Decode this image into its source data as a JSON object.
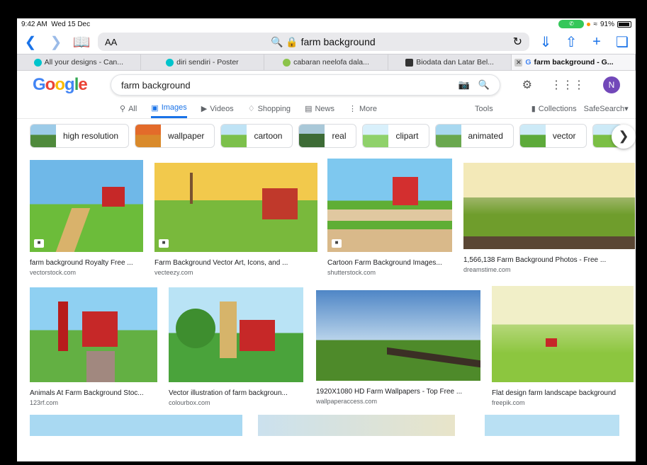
{
  "status": {
    "time": "9:42 AM",
    "date": "Wed 15 Dec",
    "battery": "91%"
  },
  "toolbar": {
    "aa": "AA",
    "url": "farm background"
  },
  "tabs": [
    {
      "label": "All your designs - Can...",
      "color": "#00c4cc"
    },
    {
      "label": "diri sendiri - Poster",
      "color": "#00c4cc"
    },
    {
      "label": "cabaran neelofa dala...",
      "color": "#8bc34a"
    },
    {
      "label": "Biodata dan Latar Bel...",
      "color": "#333333"
    },
    {
      "label": "farm background - G...",
      "color": "#4285f4"
    }
  ],
  "google": {
    "logo": [
      "G",
      "o",
      "o",
      "g",
      "l",
      "e"
    ],
    "query": "farm background",
    "avatar": "N"
  },
  "nav": {
    "all": "All",
    "images": "Images",
    "videos": "Videos",
    "shopping": "Shopping",
    "news": "News",
    "more": "More",
    "tools": "Tools",
    "collections": "Collections",
    "safesearch": "SafeSearch"
  },
  "chips": [
    {
      "label": "high resolution",
      "color": "#4f8a3c"
    },
    {
      "label": "wallpaper",
      "color": "#d98a2b"
    },
    {
      "label": "cartoon",
      "color": "#7cc04b"
    },
    {
      "label": "real",
      "color": "#3d6b36"
    },
    {
      "label": "clipart",
      "color": "#8fd16a"
    },
    {
      "label": "animated",
      "color": "#6aa84f"
    },
    {
      "label": "vector",
      "color": "#5daa3a"
    }
  ],
  "results": [
    {
      "title": "farm background Royalty Free ...",
      "source": "vectorstock.com",
      "sky": "#6fb8e8",
      "ground": "#6cbc3a"
    },
    {
      "title": "Farm Background Vector Art, Icons, and ...",
      "source": "vecteezy.com",
      "sky": "#f2c94c",
      "ground": "#79b93c"
    },
    {
      "title": "Cartoon Farm Background Images...",
      "source": "shutterstock.com",
      "sky": "#7ec8ef",
      "ground": "#5fae35"
    },
    {
      "title": "1,566,138 Farm Background Photos - Free ...",
      "source": "dreamstime.com",
      "sky": "#f3e9b8",
      "ground": "#6f9d2c"
    },
    {
      "title": "Animals At Farm Background Stoc...",
      "source": "123rf.com",
      "sky": "#8fd0f2",
      "ground": "#63b043"
    },
    {
      "title": "Vector illustration of farm backgroun...",
      "source": "colourbox.com",
      "sky": "#b9e3f5",
      "ground": "#4aa33b"
    },
    {
      "title": "1920X1080 HD Farm Wallpapers - Top Free ...",
      "source": "wallpaperaccess.com",
      "sky": "#4f86c6",
      "ground": "#4e8a2a"
    },
    {
      "title": "Flat design farm landscape background",
      "source": "freepik.com",
      "sky": "#f1efc8",
      "ground": "#8cc63f"
    }
  ]
}
